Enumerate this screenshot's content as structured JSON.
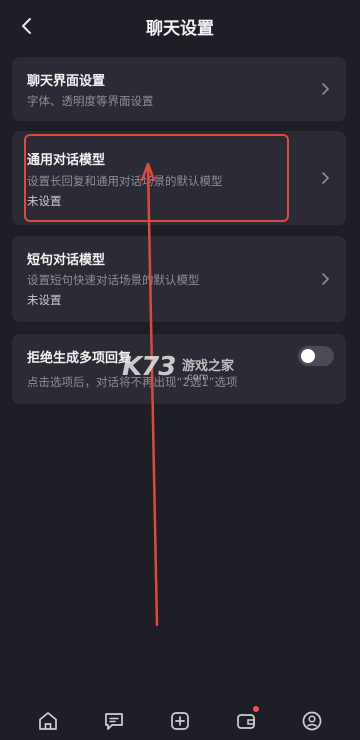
{
  "header": {
    "title": "聊天设置"
  },
  "cards": [
    {
      "title": "聊天界面设置",
      "desc": "字体、透明度等界面设置"
    },
    {
      "title": "通用对话模型",
      "desc": "设置长回复和通用对话场景的默认模型",
      "value": "未设置"
    },
    {
      "title": "短句对话模型",
      "desc": "设置短句快速对话场景的默认模型",
      "value": "未设置"
    },
    {
      "title": "拒绝生成多项回复",
      "desc": "点击选项后，对话将不再出现“2选1”选项",
      "toggle_on": false
    }
  ],
  "watermark": {
    "logo": "K73",
    "text": "游戏之家",
    "sub": ".com"
  },
  "annotation": {
    "color": "#e0483b"
  },
  "bottom_nav": [
    {
      "icon": "home-icon"
    },
    {
      "icon": "chat-icon"
    },
    {
      "icon": "plus-icon"
    },
    {
      "icon": "wallet-icon",
      "badge": true
    },
    {
      "icon": "profile-icon"
    }
  ]
}
